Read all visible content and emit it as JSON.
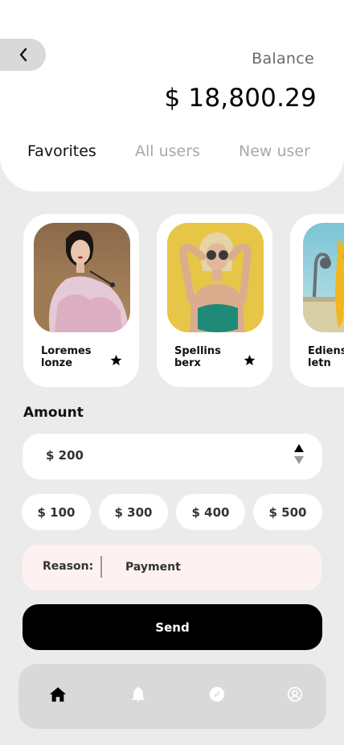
{
  "header": {
    "back_icon": "chevron-left-icon",
    "balance_label": "Balance",
    "balance_value": "$ 18,800.29"
  },
  "tabs": [
    {
      "label": "Favorites",
      "active": true
    },
    {
      "label": "All users",
      "active": false
    },
    {
      "label": "New user",
      "active": false
    }
  ],
  "favorites": [
    {
      "name_line1": "Loremes",
      "name_line2": "lonze",
      "starred": true
    },
    {
      "name_line1": "Spellins",
      "name_line2": "berx",
      "starred": true
    },
    {
      "name_line1": "Ediens",
      "name_line2": "letn",
      "starred": false
    }
  ],
  "amount": {
    "label": "Amount",
    "value": "$ 200",
    "stepper_icon": "stepper-arrows-icon"
  },
  "presets": [
    "$ 100",
    "$ 300",
    "$ 400",
    "$ 500"
  ],
  "reason": {
    "label": "Reason:",
    "value": "Payment"
  },
  "send_label": "Send",
  "nav": [
    {
      "icon": "home-icon",
      "active": true
    },
    {
      "icon": "bell-icon",
      "active": false
    },
    {
      "icon": "compass-icon",
      "active": false
    },
    {
      "icon": "profile-icon",
      "active": false
    }
  ],
  "colors": {
    "background": "#ebebeb",
    "card": "#ffffff",
    "accent": "#000000",
    "reason_bg": "#fdf1f1",
    "inactive_text": "#a9a9a9"
  }
}
